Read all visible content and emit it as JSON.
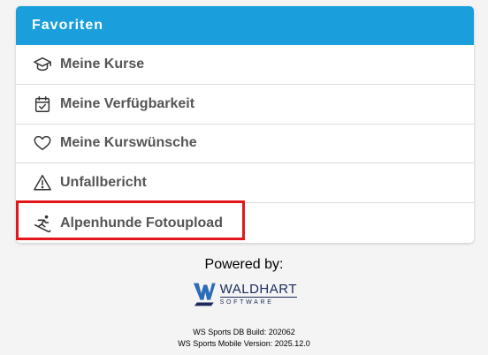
{
  "favorites": {
    "title": "Favoriten",
    "items": [
      {
        "label": "Meine Kurse",
        "icon": "graduation-cap-icon"
      },
      {
        "label": "Meine Verfügbarkeit",
        "icon": "calendar-check-icon"
      },
      {
        "label": "Meine Kurswünsche",
        "icon": "heart-icon"
      },
      {
        "label": "Unfallbericht",
        "icon": "warning-icon"
      },
      {
        "label": "Alpenhunde Fotoupload",
        "icon": "skier-icon"
      }
    ]
  },
  "footer": {
    "powered_by": "Powered by:",
    "logo_name": "WALDHART",
    "logo_sub": "SOFTWARE",
    "db_build": "WS Sports DB Build: 202062",
    "mobile_version": "WS Sports Mobile Version: 2025.12.0"
  },
  "colors": {
    "header": "#1a9fdc",
    "highlight": "#e3161b",
    "text": "#555555",
    "logo": "#1a2a5a"
  }
}
